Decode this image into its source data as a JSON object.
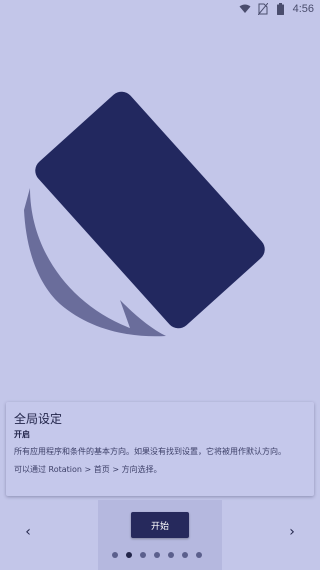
{
  "status_bar": {
    "time": "4:56",
    "icons": [
      "wifi-icon",
      "no-sim-icon",
      "battery-icon"
    ]
  },
  "illustration": {
    "icon": "rotation-phone-icon",
    "colors": {
      "phone": "#22285f",
      "arc": "#6a6d9b",
      "background": "#c3c6e9"
    }
  },
  "card": {
    "title": "全局设定",
    "subtitle": "开启",
    "body": "所有应用程序和条件的基本方向。如果没有找到设置，它将被用作默认方向。",
    "note": "可以通过 Rotation > 首页 > 方向选择。"
  },
  "nav": {
    "prev_icon": "chevron-left-icon",
    "next_icon": "chevron-right-icon",
    "prev_label": "‹",
    "next_label": "›",
    "start_label": "开始",
    "dots_total": 7,
    "active_dot": 1
  },
  "colors": {
    "background": "#c3c6e9",
    "accent": "#26295c",
    "panel": "#b5b8df"
  }
}
